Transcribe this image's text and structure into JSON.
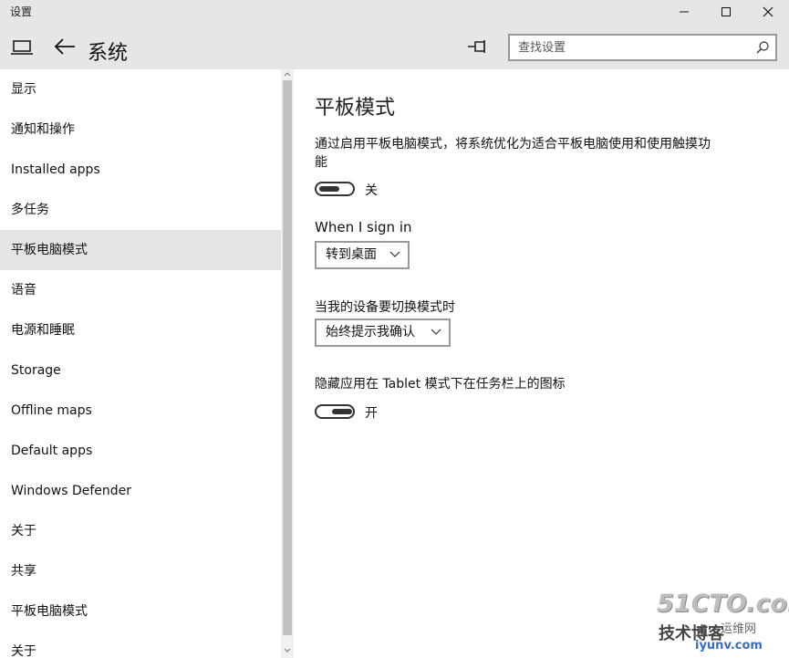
{
  "window": {
    "title": "设置"
  },
  "header": {
    "title": "系统",
    "search_placeholder": "查找设置"
  },
  "sidebar": {
    "items": [
      {
        "label": "显示",
        "selected": false
      },
      {
        "label": "通知和操作",
        "selected": false
      },
      {
        "label": "Installed apps",
        "selected": false
      },
      {
        "label": "多任务",
        "selected": false
      },
      {
        "label": "平板电脑模式",
        "selected": true
      },
      {
        "label": "语音",
        "selected": false
      },
      {
        "label": "电源和睡眠",
        "selected": false
      },
      {
        "label": "Storage",
        "selected": false
      },
      {
        "label": "Offline maps",
        "selected": false
      },
      {
        "label": "Default apps",
        "selected": false
      },
      {
        "label": "Windows Defender",
        "selected": false
      },
      {
        "label": "关于",
        "selected": false
      },
      {
        "label": "共享",
        "selected": false
      },
      {
        "label": "平板电脑模式",
        "selected": false
      },
      {
        "label": "关于",
        "selected": false
      }
    ]
  },
  "content": {
    "title": "平板模式",
    "description": "通过启用平板电脑模式，将系统优化为适合平板电脑使用和使用触摸功能",
    "tablet_toggle": {
      "on": false,
      "state_label": "关"
    },
    "sign_in_label": "When I sign in",
    "sign_in_value": "转到桌面",
    "switch_label": "当我的设备要切换模式时",
    "switch_value": "始终提示我确认",
    "hide_icons_label": "隐藏应用在 Tablet 模式下在任务栏上的图标",
    "hide_icons_toggle": {
      "on": true,
      "state_label": "开"
    }
  },
  "watermark": {
    "logo_text": "51CTO.com",
    "cn_text": "技术博客",
    "cn_text2": "运维网",
    "url": "iyunv.com"
  }
}
